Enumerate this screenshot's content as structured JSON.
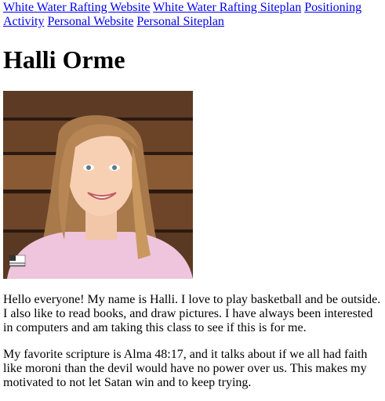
{
  "nav": {
    "links": [
      "White Water Rafting Website",
      "White Water Rafting Siteplan",
      "Positioning Activity",
      "Personal Website",
      "Personal Siteplan"
    ]
  },
  "page": {
    "title": "Halli Orme"
  },
  "content": {
    "paragraphs": [
      "Hello everyone! My name is Halli. I love to play basketball and be outside. I also like to read books, and draw pictures. I have always been interested in computers and am taking this class to see if this is for me.",
      "My favorite scripture is Alma 48:17, and it talks about if we all had faith like moroni than the devil would have no power over us. This makes my motivated to not let Satan win and to keep trying."
    ]
  }
}
